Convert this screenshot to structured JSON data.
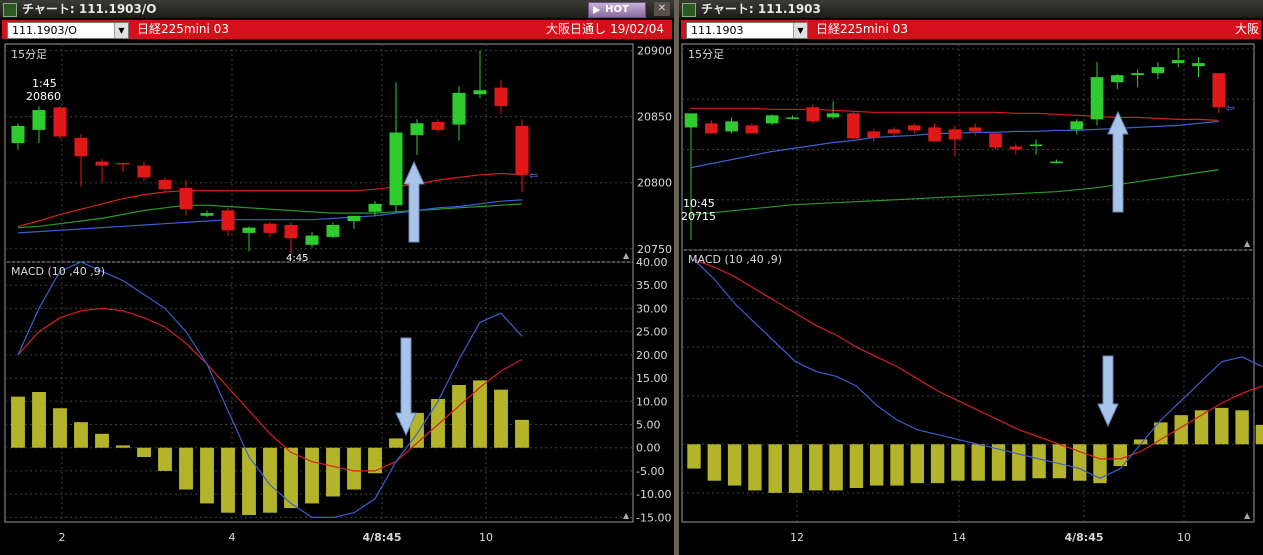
{
  "left": {
    "title": "チャート: 111.1903/O",
    "hot": "HOT",
    "symbol": "111.1903/O",
    "instrument": "日経225mini 03",
    "session": "大阪日通し",
    "date": "19/02/04",
    "period": "15分足",
    "price_axis": [
      "20900",
      "20850",
      "20800",
      "20750"
    ],
    "price_annotation": {
      "time": "1:45",
      "value": "20860"
    },
    "low_time_label": "4:45",
    "macd_label": "MACD (10 ,40 ,9)",
    "macd_axis": [
      "40.00",
      "35.00",
      "30.00",
      "25.00",
      "20.00",
      "15.00",
      "10.00",
      "5.00",
      "0.00",
      "-5.00",
      "-10.00",
      "-15.00"
    ],
    "x_labels": [
      "2",
      "4",
      "4/8:45",
      "10"
    ]
  },
  "right": {
    "title": "チャート: 111.1903",
    "symbol": "111.1903",
    "instrument": "日経225mini 03",
    "session": "大阪",
    "period": "15分足",
    "price_annotation": {
      "time": "10:45",
      "value": "20715"
    },
    "macd_label": "MACD (10 ,40 ,9)",
    "x_labels": [
      "12",
      "14",
      "4/8:45",
      "10"
    ]
  },
  "colors": {
    "up": "#2ecc2e",
    "down": "#e01818",
    "histogram": "#b4b42a",
    "macd": "#3a5ed0",
    "signal": "#d42020",
    "arrow": "#a8c4e8",
    "bar": "#d4101c"
  },
  "chart_data": [
    {
      "type": "candlestick",
      "name": "left-price",
      "ylim": [
        20740,
        20905
      ],
      "candles": [
        {
          "o": 20830,
          "h": 20845,
          "l": 20825,
          "c": 20843
        },
        {
          "o": 20840,
          "h": 20858,
          "l": 20830,
          "c": 20855
        },
        {
          "o": 20857,
          "h": 20858,
          "l": 20833,
          "c": 20835
        },
        {
          "o": 20834,
          "h": 20837,
          "l": 20797,
          "c": 20820
        },
        {
          "o": 20816,
          "h": 20818,
          "l": 20800,
          "c": 20813
        },
        {
          "o": 20815,
          "h": 20815,
          "l": 20808,
          "c": 20814
        },
        {
          "o": 20813,
          "h": 20816,
          "l": 20801,
          "c": 20804
        },
        {
          "o": 20802,
          "h": 20804,
          "l": 20793,
          "c": 20795
        },
        {
          "o": 20796,
          "h": 20802,
          "l": 20775,
          "c": 20780
        },
        {
          "o": 20775,
          "h": 20779,
          "l": 20774,
          "c": 20777
        },
        {
          "o": 20779,
          "h": 20781,
          "l": 20760,
          "c": 20764
        },
        {
          "o": 20762,
          "h": 20767,
          "l": 20748,
          "c": 20766
        },
        {
          "o": 20769,
          "h": 20770,
          "l": 20759,
          "c": 20762
        },
        {
          "o": 20768,
          "h": 20770,
          "l": 20745,
          "c": 20758
        },
        {
          "o": 20753,
          "h": 20763,
          "l": 20751,
          "c": 20760
        },
        {
          "o": 20759,
          "h": 20770,
          "l": 20758,
          "c": 20768
        },
        {
          "o": 20771,
          "h": 20774,
          "l": 20765,
          "c": 20775
        },
        {
          "o": 20778,
          "h": 20786,
          "l": 20775,
          "c": 20784
        },
        {
          "o": 20783,
          "h": 20876,
          "l": 20778,
          "c": 20838
        },
        {
          "o": 20836,
          "h": 20848,
          "l": 20821,
          "c": 20845
        },
        {
          "o": 20846,
          "h": 20848,
          "l": 20838,
          "c": 20840
        },
        {
          "o": 20844,
          "h": 20873,
          "l": 20832,
          "c": 20868
        },
        {
          "o": 20867,
          "h": 20900,
          "l": 20864,
          "c": 20870
        },
        {
          "o": 20872,
          "h": 20878,
          "l": 20852,
          "c": 20858
        },
        {
          "o": 20843,
          "h": 20848,
          "l": 20793,
          "c": 20806
        }
      ],
      "ma_red": [
        20767,
        20771,
        20776,
        20780,
        20784,
        20788,
        20791,
        20793,
        20794,
        20794,
        20794,
        20794,
        20794,
        20794,
        20794,
        20794,
        20794,
        20795,
        20797,
        20799,
        20802,
        20804,
        20806,
        20807,
        20806
      ],
      "ma_blue": [
        20762,
        20763,
        20764,
        20765,
        20766,
        20767,
        20768,
        20769,
        20770,
        20771,
        20772,
        20772,
        20772,
        20772,
        20772,
        20773,
        20774,
        20775,
        20777,
        20779,
        20781,
        20782,
        20784,
        20786,
        20787
      ],
      "ma_green": [
        20766,
        20767,
        20769,
        20771,
        20773,
        20776,
        20779,
        20781,
        20783,
        20783,
        20782,
        20781,
        20780,
        20779,
        20778,
        20777,
        20777,
        20777,
        20778,
        20779,
        20780,
        20781,
        20782,
        20783,
        20784
      ]
    },
    {
      "type": "bar+line",
      "name": "left-macd",
      "ylim": [
        -16,
        40
      ],
      "histogram": [
        11,
        12,
        8.5,
        5.5,
        3,
        0.5,
        -2,
        -5,
        -9,
        -12,
        -14,
        -14.5,
        -14,
        -13,
        -12,
        -10.5,
        -9,
        -5.5,
        2,
        7.5,
        10.5,
        13.5,
        14.5,
        12.5,
        6
      ],
      "macd": [
        20,
        30,
        38,
        40,
        38,
        36,
        33,
        30,
        25,
        18,
        8,
        -2,
        -8,
        -12,
        -15,
        -15,
        -14,
        -11,
        -3,
        3,
        10,
        19,
        27,
        29,
        24
      ],
      "signal": [
        20,
        25,
        28,
        29.5,
        30,
        29.5,
        28,
        26,
        22.5,
        18,
        13,
        8,
        3,
        -1,
        -3,
        -4,
        -5,
        -5,
        -3,
        1,
        5,
        9,
        13,
        16.5,
        19
      ]
    },
    {
      "type": "candlestick",
      "name": "right-price",
      "ylim": [
        20700,
        20905
      ],
      "candles": [
        {
          "o": 20822,
          "h": 20836,
          "l": 20710,
          "c": 20836
        },
        {
          "o": 20826,
          "h": 20829,
          "l": 20816,
          "c": 20816
        },
        {
          "o": 20818,
          "h": 20832,
          "l": 20816,
          "c": 20828
        },
        {
          "o": 20824,
          "h": 20826,
          "l": 20816,
          "c": 20816
        },
        {
          "o": 20826,
          "h": 20835,
          "l": 20824,
          "c": 20834
        },
        {
          "o": 20832,
          "h": 20834,
          "l": 20830,
          "c": 20832
        },
        {
          "o": 20842,
          "h": 20845,
          "l": 20826,
          "c": 20828
        },
        {
          "o": 20832,
          "h": 20848,
          "l": 20830,
          "c": 20836
        },
        {
          "o": 20836,
          "h": 20838,
          "l": 20810,
          "c": 20811
        },
        {
          "o": 20818,
          "h": 20820,
          "l": 20808,
          "c": 20812
        },
        {
          "o": 20820,
          "h": 20822,
          "l": 20814,
          "c": 20816
        },
        {
          "o": 20824,
          "h": 20826,
          "l": 20816,
          "c": 20819
        },
        {
          "o": 20822,
          "h": 20826,
          "l": 20808,
          "c": 20808
        },
        {
          "o": 20820,
          "h": 20824,
          "l": 20793,
          "c": 20810
        },
        {
          "o": 20822,
          "h": 20826,
          "l": 20814,
          "c": 20818
        },
        {
          "o": 20816,
          "h": 20818,
          "l": 20800,
          "c": 20802
        },
        {
          "o": 20803,
          "h": 20806,
          "l": 20795,
          "c": 20800
        },
        {
          "o": 20805,
          "h": 20810,
          "l": 20795,
          "c": 20805
        },
        {
          "o": 20788,
          "h": 20790,
          "l": 20786,
          "c": 20788
        },
        {
          "o": 20820,
          "h": 20830,
          "l": 20815,
          "c": 20828
        },
        {
          "o": 20830,
          "h": 20887,
          "l": 20824,
          "c": 20872
        },
        {
          "o": 20867,
          "h": 20875,
          "l": 20860,
          "c": 20874
        },
        {
          "o": 20874,
          "h": 20880,
          "l": 20862,
          "c": 20876
        },
        {
          "o": 20876,
          "h": 20887,
          "l": 20870,
          "c": 20882
        },
        {
          "o": 20886,
          "h": 20901,
          "l": 20882,
          "c": 20889
        },
        {
          "o": 20883,
          "h": 20892,
          "l": 20872,
          "c": 20886
        },
        {
          "o": 20876,
          "h": 20876,
          "l": 20836,
          "c": 20842
        }
      ],
      "ma_red": [
        20841,
        20841,
        20841,
        20841,
        20840,
        20840,
        20840,
        20839,
        20838,
        20837,
        20837,
        20837,
        20837,
        20837,
        20837,
        20837,
        20836,
        20836,
        20835,
        20834,
        20833,
        20832,
        20832,
        20831,
        20830,
        20830,
        20829
      ],
      "ma_blue": [
        20782,
        20786,
        20790,
        20794,
        20798,
        20801,
        20804,
        20807,
        20809,
        20812,
        20813,
        20814,
        20816,
        20816,
        20817,
        20817,
        20818,
        20818,
        20819,
        20819,
        20820,
        20821,
        20822,
        20823,
        20824,
        20826,
        20828
      ],
      "ma_green": [
        20735,
        20737,
        20739,
        20741,
        20743,
        20745,
        20746,
        20747,
        20748,
        20749,
        20750,
        20751,
        20752,
        20753,
        20754,
        20755,
        20756,
        20757,
        20758,
        20760,
        20762,
        20765,
        20768,
        20771,
        20774,
        20777,
        20780
      ]
    },
    {
      "type": "bar+line",
      "name": "right-macd",
      "ylim": [
        -16,
        40
      ],
      "histogram": [
        -5,
        -7.5,
        -8.5,
        -9.5,
        -10,
        -10,
        -9.5,
        -9.5,
        -9,
        -8.5,
        -8.5,
        -8,
        -8,
        -7.5,
        -7.5,
        -7.5,
        -7.5,
        -7,
        -7,
        -7.5,
        -8,
        -4.5,
        1,
        4.5,
        6,
        7,
        7.5,
        7,
        4
      ],
      "macd": [
        38,
        34,
        29,
        25,
        21,
        17,
        15,
        14,
        12,
        8,
        5,
        3,
        2,
        1,
        0,
        -1,
        -2,
        -3,
        -4,
        -5,
        -7,
        -5,
        0,
        5,
        9,
        13,
        17,
        18,
        16
      ],
      "signal": [
        38,
        36.5,
        34.5,
        32,
        29.5,
        27,
        24.5,
        22.5,
        20,
        18,
        16,
        13.5,
        11,
        9,
        7,
        5,
        3,
        1.5,
        0,
        -1.5,
        -3,
        -3,
        -1.5,
        1,
        3.5,
        6,
        8.5,
        10.5,
        12
      ]
    }
  ]
}
